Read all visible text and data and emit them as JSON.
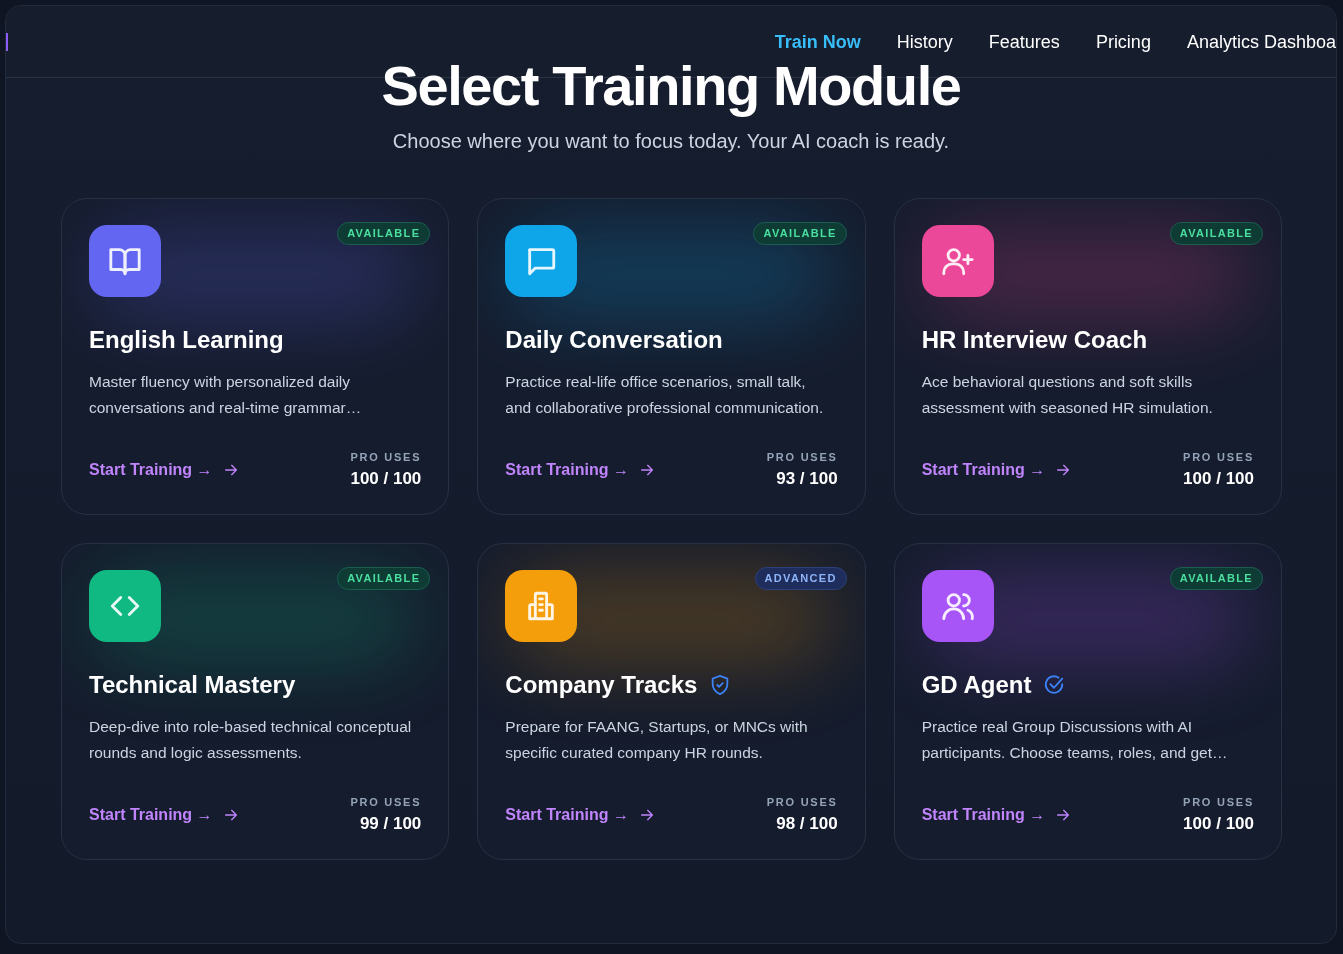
{
  "nav": [
    {
      "label": "Train Now",
      "selected": true
    },
    {
      "label": "History",
      "selected": false
    },
    {
      "label": "Features",
      "selected": false
    },
    {
      "label": "Pricing",
      "selected": false
    },
    {
      "label": "Analytics Dashboa",
      "selected": false
    }
  ],
  "heading": "Select Training Module",
  "subheading": "Choose where you want to focus today. Your AI coach is ready.",
  "modules": [
    {
      "title": "English Learning",
      "color": "#6366f1",
      "badge": {
        "label": "AVAILABLE",
        "kind": "available"
      },
      "description": "Master fluency with personalized daily conversations and real-time grammar…",
      "link": "Start Training →",
      "uses_label": "PRO USES",
      "uses": "100 / 100"
    },
    {
      "title": "Daily Conversation",
      "color": "#0ea5e9",
      "badge": {
        "label": "AVAILABLE",
        "kind": "available"
      },
      "description": "Practice real-life office scenarios, small talk, and collaborative professional communication.",
      "link": "Start Training →",
      "uses_label": "PRO USES",
      "uses": "93 / 100"
    },
    {
      "title": "HR Interview Coach",
      "color": "#ec4899",
      "badge": {
        "label": "AVAILABLE",
        "kind": "available"
      },
      "description": "Ace behavioral questions and soft skills assessment with seasoned HR simulation.",
      "link": "Start Training →",
      "uses_label": "PRO USES",
      "uses": "100 / 100"
    },
    {
      "title": "Technical Mastery",
      "color": "#10b981",
      "badge": {
        "label": "AVAILABLE",
        "kind": "available"
      },
      "description": "Deep-dive into role-based technical conceptual rounds and logic assessments.",
      "link": "Start Training →",
      "uses_label": "PRO USES",
      "uses": "99 / 100"
    },
    {
      "title": "Company Tracks",
      "color": "#f59e0b",
      "badge": {
        "label": "ADVANCED",
        "kind": "advanced"
      },
      "description": "Prepare for FAANG, Startups, or MNCs with specific curated company HR rounds.",
      "link": "Start Training →",
      "uses_label": "PRO USES",
      "uses": "98 / 100"
    },
    {
      "title": "GD Agent",
      "color": "#a855f7",
      "badge": {
        "label": "AVAILABLE",
        "kind": "available"
      },
      "description": "Practice real Group Discussions with AI participants. Choose teams, roles, and get…",
      "link": "Start Training →",
      "uses_label": "PRO USES",
      "uses": "100 / 100"
    }
  ]
}
